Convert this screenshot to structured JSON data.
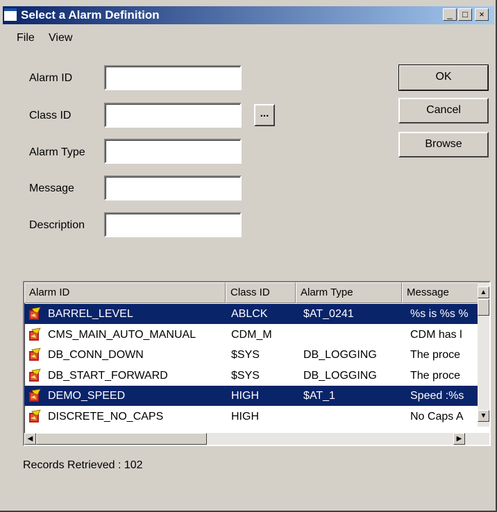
{
  "window": {
    "title": "Select a Alarm Definition",
    "controls": [
      "_",
      "□",
      "×"
    ]
  },
  "menu": [
    {
      "label": "File"
    },
    {
      "label": "View"
    }
  ],
  "fields": [
    {
      "label": "Alarm ID",
      "value": ""
    },
    {
      "label": "Class ID",
      "value": ""
    },
    {
      "label": "Alarm Type",
      "value": ""
    },
    {
      "label": "Message",
      "value": ""
    },
    {
      "label": "Description",
      "value": ""
    }
  ],
  "browse_dots_label": "...",
  "buttons": {
    "ok": "OK",
    "cancel": "Cancel",
    "browse": "Browse"
  },
  "table": {
    "columns": [
      "Alarm ID",
      "Class ID",
      "Alarm Type",
      "Message"
    ],
    "rows": [
      {
        "alarm_id": "BARREL_LEVEL",
        "class_id": "ABLCK",
        "alarm_type": "$AT_0241",
        "message": "%s is %s %",
        "selected": true
      },
      {
        "alarm_id": "CMS_MAIN_AUTO_MANUAL",
        "class_id": "CDM_M",
        "alarm_type": "",
        "message": "CDM has l",
        "selected": false
      },
      {
        "alarm_id": "DB_CONN_DOWN",
        "class_id": "$SYS",
        "alarm_type": "DB_LOGGING",
        "message": "The proce",
        "selected": false
      },
      {
        "alarm_id": "DB_START_FORWARD",
        "class_id": "$SYS",
        "alarm_type": "DB_LOGGING",
        "message": "The proce",
        "selected": false
      },
      {
        "alarm_id": "DEMO_SPEED",
        "class_id": "HIGH",
        "alarm_type": "$AT_1",
        "message": "Speed :%s",
        "selected": true
      },
      {
        "alarm_id": "DISCRETE_NO_CAPS",
        "class_id": "HIGH",
        "alarm_type": "",
        "message": "No Caps A",
        "selected": false
      }
    ]
  },
  "status": "Records Retrieved : 102",
  "colors": {
    "titlebar": "#0a246a",
    "selection": "#0a246a",
    "face": "#d4d0c8"
  },
  "icons": [
    "alarm-definition-icon"
  ]
}
